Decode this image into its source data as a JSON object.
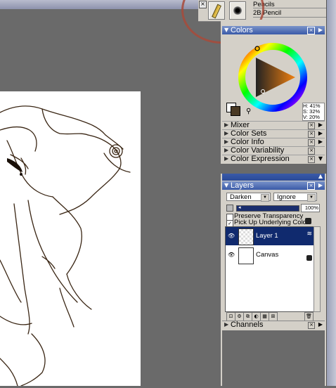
{
  "brush_selector": {
    "category": "Pencils",
    "variant": "2B Pencil",
    "category_icon": "pencil-icon",
    "variant_icon": "brush-dab-icon"
  },
  "colors_panel": {
    "title": "Colors",
    "hsv": {
      "h": "H: 41%",
      "s": "S: 32%",
      "v": "V: 20%"
    },
    "main_color": "#4a3a24",
    "secondary_color": "#ffffff"
  },
  "collapsed_panels": [
    "Mixer",
    "Color Sets",
    "Color Info",
    "Color Variability",
    "Color Expression"
  ],
  "layers_panel": {
    "title": "Layers",
    "composite_method": "Darken",
    "composite_depth": "Ignore",
    "opacity": "100%",
    "preserve_transparency": {
      "label": "Preserve Transparency",
      "checked": false
    },
    "pick_up_underlying_color": {
      "label": "Pick Up Underlying Color",
      "checked": true
    },
    "layers": [
      {
        "name": "Layer 1",
        "selected": true,
        "visible": true
      },
      {
        "name": "Canvas",
        "selected": false,
        "visible": true
      }
    ]
  },
  "channels_panel": {
    "title": "Channels"
  },
  "accent_colors": {
    "panel_header": "#3a5aa8",
    "selection": "#102a6e",
    "annotation": "#a84a3a"
  }
}
